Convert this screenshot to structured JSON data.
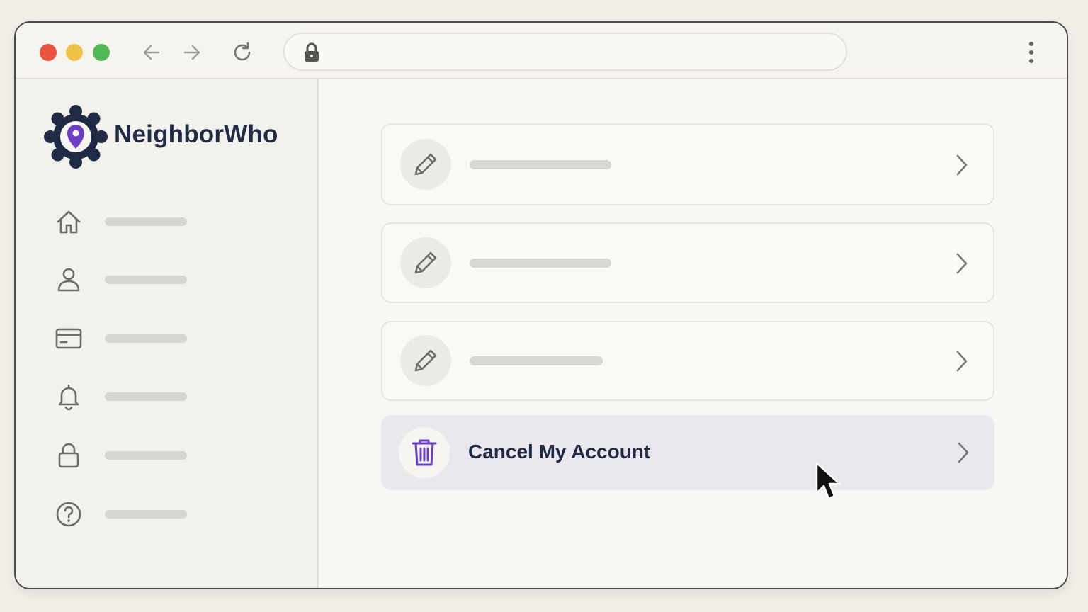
{
  "browser": {
    "url": "",
    "traffic_lights": {
      "close": "#e8523e",
      "minimize": "#f2c14a",
      "maximize": "#4fb955"
    },
    "icons": [
      "back-arrow-icon",
      "forward-arrow-icon",
      "reload-icon",
      "lock-icon",
      "kebab-menu-icon"
    ]
  },
  "sidebar": {
    "brand": "NeighborWho",
    "brand_color": "#1f2a44",
    "logo_accent": "#6d3fc4",
    "items": [
      {
        "icon": "home-icon",
        "label": ""
      },
      {
        "icon": "user-icon",
        "label": ""
      },
      {
        "icon": "credit-card-icon",
        "label": ""
      },
      {
        "icon": "bell-icon",
        "label": ""
      },
      {
        "icon": "lock-icon",
        "label": ""
      },
      {
        "icon": "help-icon",
        "label": ""
      }
    ]
  },
  "main": {
    "settings_rows": [
      {
        "icon": "pencil-icon",
        "label": ""
      },
      {
        "icon": "pencil-icon",
        "label": ""
      },
      {
        "icon": "pencil-icon",
        "label": ""
      }
    ],
    "cancel_row": {
      "icon": "trash-icon",
      "label": "Cancel My Account",
      "accent": "#6d3fc4"
    }
  }
}
